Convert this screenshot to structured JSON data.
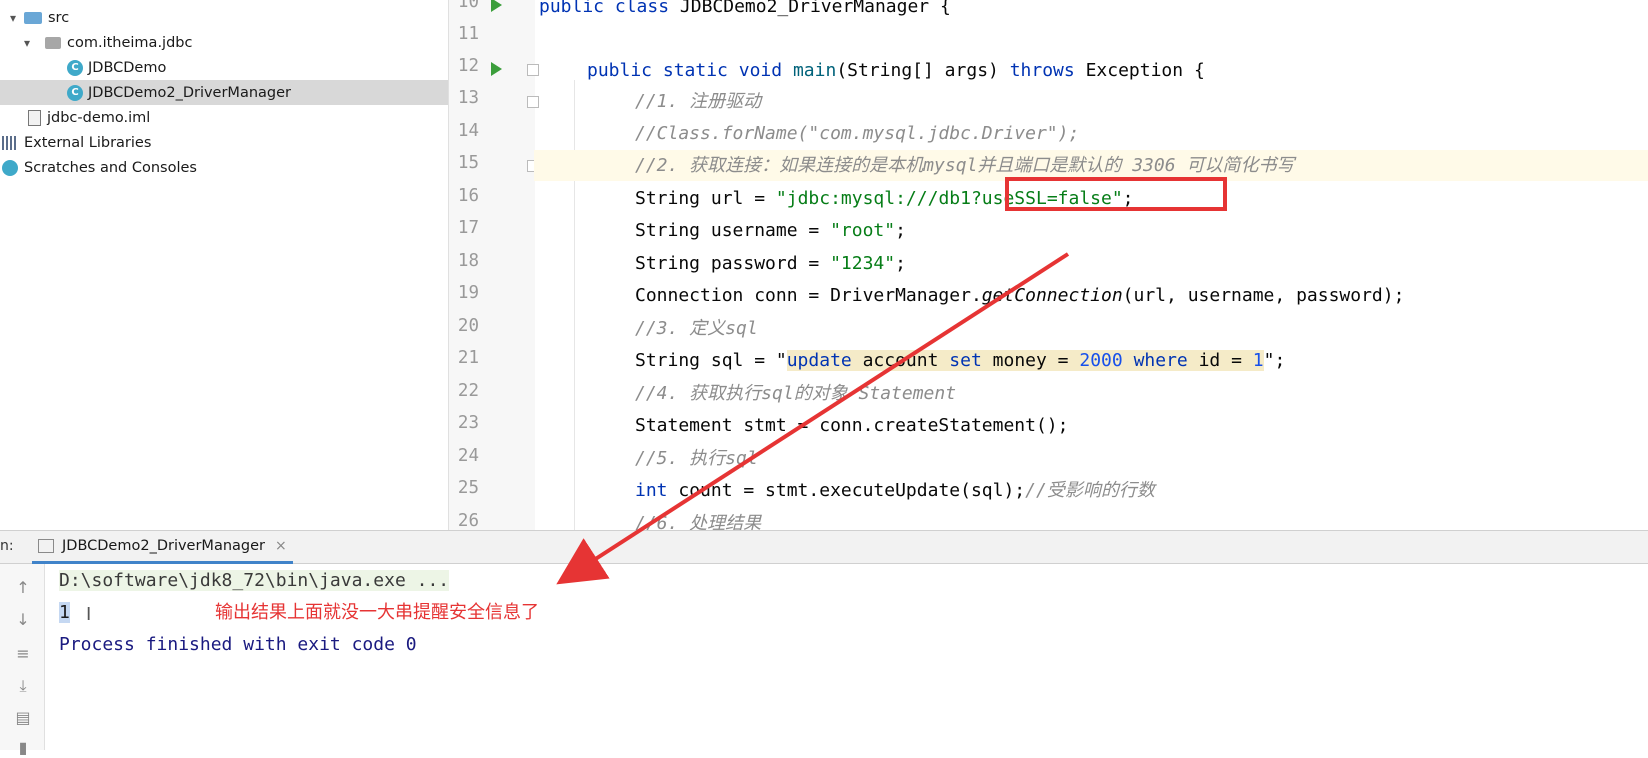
{
  "project_tree": {
    "items": [
      {
        "label": "src",
        "kind": "folder"
      },
      {
        "label": "com.itheima.jdbc",
        "kind": "package"
      },
      {
        "label": "JDBCDemo",
        "kind": "class"
      },
      {
        "label": "JDBCDemo2_DriverManager",
        "kind": "class",
        "selected": true
      },
      {
        "label": "jdbc-demo.iml",
        "kind": "file"
      },
      {
        "label": "External Libraries",
        "kind": "libraries"
      },
      {
        "label": "Scratches and Consoles",
        "kind": "scratches"
      }
    ]
  },
  "editor": {
    "line_numbers": [
      "10",
      "11",
      "12",
      "13",
      "14",
      "15",
      "16",
      "17",
      "18",
      "19",
      "20",
      "21",
      "22",
      "23",
      "24",
      "25",
      "26"
    ],
    "current_line": "15",
    "code": {
      "l10": {
        "kw1": "public",
        "kw2": "class",
        "rest": " JDBCDemo2_DriverManager {"
      },
      "l12": {
        "kw1": "public",
        "kw2": "static",
        "kw3": "void",
        "fn": "main",
        "mid": "(String[] args) ",
        "kw4": "throws",
        "rest": " Exception {"
      },
      "l13": "//1. 注册驱动",
      "l14": "//Class.forName(\"com.mysql.jdbc.Driver\");",
      "l15": "//2. 获取连接：如果连接的是本机mysql并且端口是默认的 3306 可以简化书写",
      "l16": {
        "pre": "String url = ",
        "str": "\"jdbc:mysql:///db1?useSSL=false\"",
        "post": ";"
      },
      "l17": {
        "pre": "String username = ",
        "str": "\"root\"",
        "post": ";"
      },
      "l18": {
        "pre": "String password = ",
        "str": "\"1234\"",
        "post": ";"
      },
      "l19": {
        "pre": "Connection conn = DriverManager.",
        "it": "getConnection",
        "post": "(url, username, password);"
      },
      "l20": "//3. 定义sql",
      "l21": {
        "pre": "String sql = \"",
        "k1": "update",
        "a1": " account ",
        "k2": "set",
        "a2": " money = ",
        "n1": "2000",
        "a3": " ",
        "k3": "where",
        "a4": " id = ",
        "n2": "1",
        "post": "\";"
      },
      "l22": "//4. 获取执行sql的对象 Statement",
      "l23": "Statement stmt = conn.createStatement();",
      "l24": "//5. 执行sql",
      "l25": {
        "kw": "int",
        "rest": " count = stmt.executeUpdate(sql);",
        "cm": "//受影响的行数"
      },
      "l26": "//6. 处理结果"
    }
  },
  "run_window": {
    "label_prefix": "n:",
    "tab_label": "JDBCDemo2_DriverManager",
    "tab_close": "×",
    "console": {
      "command": "D:\\software\\jdk8_72\\bin\\java.exe ...",
      "output": "1",
      "finished": "Process finished with exit code 0"
    }
  },
  "annotation": {
    "text": "输出结果上面就没一大串提醒安全信息了",
    "color": "#e63434"
  },
  "colors": {
    "keyword": "#0033b3",
    "string": "#067d17",
    "comment": "#8c8c8c",
    "number": "#1750eb",
    "console_cmd": "#3a3a3a",
    "console_text": "#1a1a80"
  }
}
